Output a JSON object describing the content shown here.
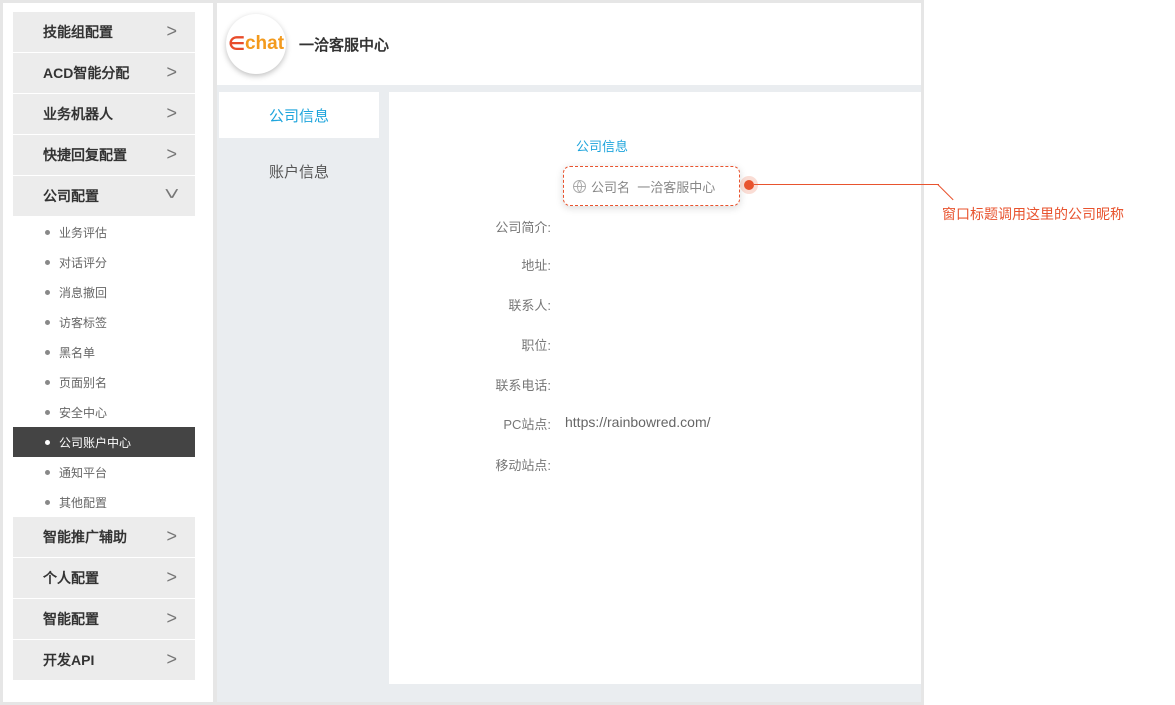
{
  "sidebar": {
    "groups_top": [
      {
        "label": "技能组配置"
      },
      {
        "label": "ACD智能分配"
      },
      {
        "label": "业务机器人"
      },
      {
        "label": "快捷回复配置"
      },
      {
        "label": "公司配置"
      }
    ],
    "sub_items": [
      {
        "label": "业务评估"
      },
      {
        "label": "对话评分"
      },
      {
        "label": "消息撤回"
      },
      {
        "label": "访客标签"
      },
      {
        "label": "黑名单"
      },
      {
        "label": "页面别名"
      },
      {
        "label": "安全中心"
      },
      {
        "label": "公司账户中心"
      },
      {
        "label": "通知平台"
      },
      {
        "label": "其他配置"
      }
    ],
    "groups_bottom": [
      {
        "label": "智能推广辅助"
      },
      {
        "label": "个人配置"
      },
      {
        "label": "智能配置"
      },
      {
        "label": "开发API"
      }
    ]
  },
  "header": {
    "logo_text": "chat",
    "title": "一洽客服中心"
  },
  "tabs": [
    {
      "label": "公司信息"
    },
    {
      "label": "账户信息"
    }
  ],
  "form": {
    "section_title": "公司信息",
    "company_name_label": "公司名",
    "company_name_value": "一洽客服中心",
    "fields": [
      {
        "label": "公司简介:",
        "value": ""
      },
      {
        "label": "地址:",
        "value": ""
      },
      {
        "label": "联系人:",
        "value": ""
      },
      {
        "label": "职位:",
        "value": ""
      },
      {
        "label": "联系电话:",
        "value": ""
      },
      {
        "label": "PC站点:",
        "value": "https://rainbowred.com/"
      },
      {
        "label": "移动站点:",
        "value": ""
      }
    ]
  },
  "annotation": {
    "text": "窗口标题调用这里的公司昵称",
    "color": "#e8532e"
  }
}
